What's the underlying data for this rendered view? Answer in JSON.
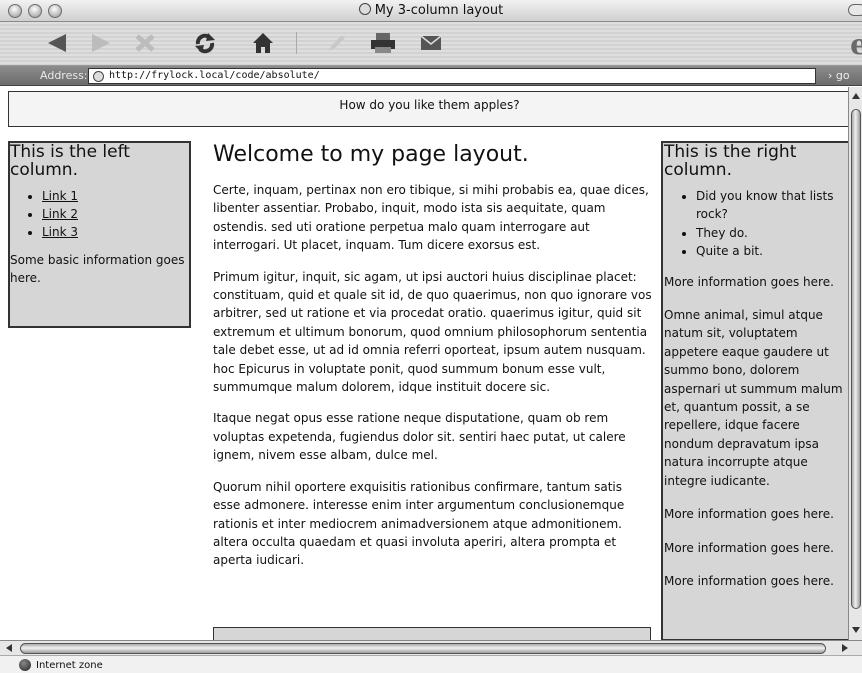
{
  "window": {
    "title": "My 3-column layout"
  },
  "toolbar": {
    "buttons": [
      {
        "name": "back-button",
        "icon": "back-arrow-icon"
      },
      {
        "name": "forward-button",
        "icon": "forward-arrow-icon"
      },
      {
        "name": "stop-button",
        "icon": "stop-x-icon"
      },
      {
        "name": "refresh-button",
        "icon": "refresh-icon"
      },
      {
        "name": "home-button",
        "icon": "home-icon"
      },
      {
        "name": "autofill-button",
        "icon": "pencil-icon"
      },
      {
        "name": "print-button",
        "icon": "printer-icon"
      },
      {
        "name": "mail-button",
        "icon": "mail-icon"
      }
    ]
  },
  "address": {
    "label": "Address:",
    "url": "http://frylock.local/code/absolute/",
    "go_label": "go"
  },
  "page": {
    "header_text": "How do you like them apples?",
    "left": {
      "heading": "This is the left column.",
      "links": [
        "Link 1",
        "Link 2",
        "Link 3"
      ],
      "info": "Some basic information goes here."
    },
    "main": {
      "heading": "Welcome to my page layout.",
      "paragraphs": [
        "Certe, inquam, pertinax non ero tibique, si mihi probabis ea, quae dices, libenter assentiar. Probabo, inquit, modo ista sis aequitate, quam ostendis. sed uti oratione perpetua malo quam interrogare aut interrogari. Ut placet, inquam. Tum dicere exorsus est.",
        "Primum igitur, inquit, sic agam, ut ipsi auctori huius disciplinae placet: constituam, quid et quale sit id, de quo quaerimus, non quo ignorare vos arbitrer, sed ut ratione et via procedat oratio. quaerimus igitur, quid sit extremum et ultimum bonorum, quod omnium philosophorum sententia tale debet esse, ut ad id omnia referri oporteat, ipsum autem nusquam. hoc Epicurus in voluptate ponit, quod summum bonum esse vult, summumque malum dolorem, idque instituit docere sic.",
        "Itaque negat opus esse ratione neque disputatione, quam ob rem voluptas expetenda, fugiendus dolor sit. sentiri haec putat, ut calere ignem, nivem esse albam, dulce mel.",
        "Quorum nihil oportere exquisitis rationibus confirmare, tantum satis esse admonere. interesse enim inter argumentum conclusionemque rationis et inter mediocrem animadversionem atque admonitionem. altera occulta quaedam et quasi involuta aperiri, altera prompta et aperta iudicari."
      ]
    },
    "right": {
      "heading": "This is the right column.",
      "list": [
        "Did you know that lists rock?",
        "They do.",
        "Quite a bit."
      ],
      "more_1": "More information goes here.",
      "paragraph": "Omne animal, simul atque natum sit, voluptatem appetere eaque gaudere ut summo bono, dolorem aspernari ut summum malum et, quantum possit, a se repellere, idque facere nondum depravatum ipsa natura incorrupte atque integre iudicante.",
      "more_2": "More information goes here.",
      "more_3": "More information goes here.",
      "more_4": "More information goes here."
    }
  },
  "status": {
    "zone": "Internet zone"
  }
}
